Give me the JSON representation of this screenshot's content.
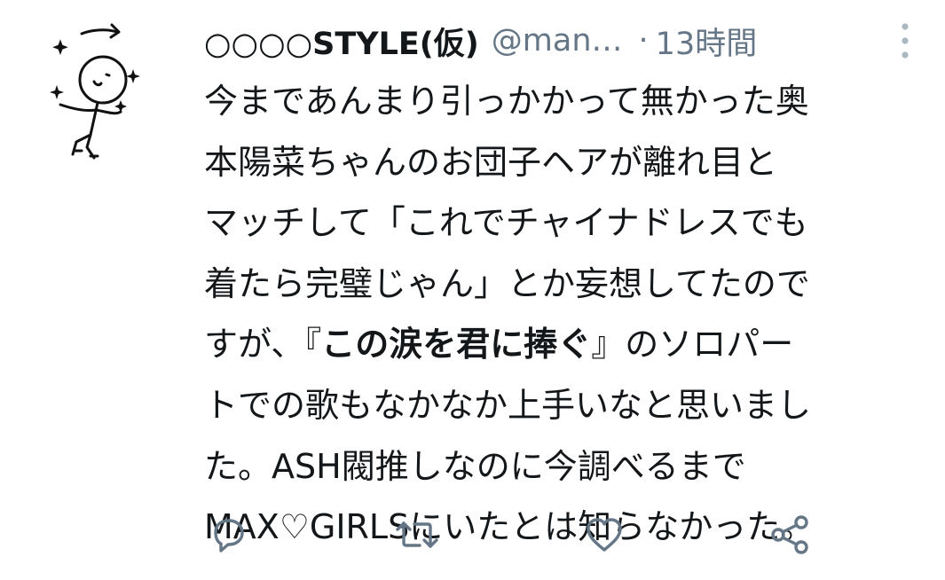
{
  "tweet": {
    "display_name": "○○○○STYLE(仮)",
    "handle": "@man…",
    "dot": "·",
    "time": "13時間",
    "body_lines": [
      {
        "text": "今まであんまり引っかかって無かった奥"
      },
      {
        "text": "本陽菜ちゃんのお団子ヘアが離れ目と"
      },
      {
        "text": "マッチして「これでチャイナドレスでも"
      },
      {
        "text": "着たら完璧じゃん」とか妄想してたので"
      },
      {
        "pre": "すが、『",
        "bold": "この涙を君に捧ぐ",
        "post": "』のソロパー"
      },
      {
        "text": "トでの歌もなかなか上手いなと思いまし"
      },
      {
        "text": "た。ASH閥推しなのに今調べるまで"
      },
      {
        "text": "MAX♡GIRLSにいたとは知らなかった。"
      }
    ]
  },
  "icons": {
    "avatar": "stick-figure-avatar",
    "more": "more-vertical-icon",
    "reply": "reply-icon",
    "retweet": "retweet-icon",
    "like": "heart-icon",
    "share": "share-icon"
  },
  "colors": {
    "text": "#14171a",
    "secondary": "#657786",
    "icon": "#657786",
    "background": "#ffffff"
  }
}
